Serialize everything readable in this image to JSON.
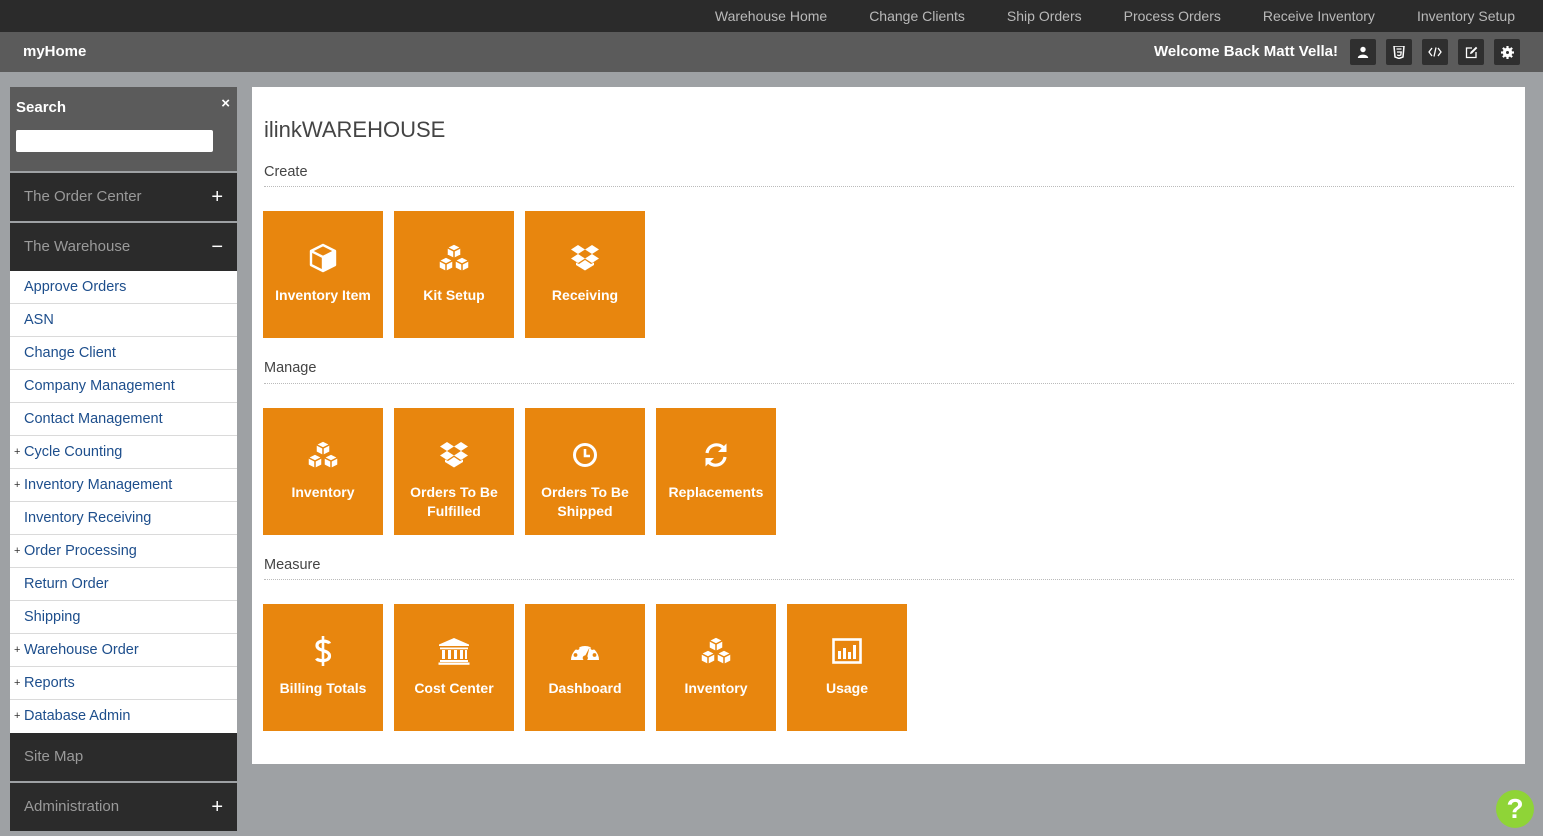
{
  "top_nav": [
    "Warehouse Home",
    "Change Clients",
    "Ship Orders",
    "Process Orders",
    "Receive Inventory",
    "Inventory Setup"
  ],
  "header": {
    "brand": "myHome",
    "welcome": "Welcome Back Matt Vella!",
    "buttons": [
      "user-icon",
      "html5-icon",
      "code-icon",
      "edit-icon",
      "gear-icon"
    ]
  },
  "sidebar": {
    "search": {
      "title": "Search",
      "close": "×",
      "value": "",
      "placeholder": ""
    },
    "order_center": {
      "label": "The Order Center",
      "toggle": "+"
    },
    "warehouse": {
      "label": "The Warehouse",
      "toggle": "−",
      "items": [
        {
          "label": "Approve Orders",
          "expand": ""
        },
        {
          "label": "ASN",
          "expand": ""
        },
        {
          "label": "Change Client",
          "expand": ""
        },
        {
          "label": "Company Management",
          "expand": ""
        },
        {
          "label": "Contact Management",
          "expand": ""
        },
        {
          "label": "Cycle Counting",
          "expand": "+"
        },
        {
          "label": "Inventory Management",
          "expand": "+"
        },
        {
          "label": "Inventory Receiving",
          "expand": ""
        },
        {
          "label": "Order Processing",
          "expand": "+"
        },
        {
          "label": "Return Order",
          "expand": ""
        },
        {
          "label": "Shipping",
          "expand": ""
        },
        {
          "label": "Warehouse Order",
          "expand": "+"
        },
        {
          "label": "Reports",
          "expand": "+"
        },
        {
          "label": "Database Admin",
          "expand": "+"
        }
      ]
    },
    "site_map": {
      "label": "Site Map"
    },
    "administration": {
      "label": "Administration",
      "toggle": "+"
    }
  },
  "main": {
    "title": "ilinkWAREHOUSE",
    "tile_color": "#e8860e",
    "groups": [
      {
        "label": "Create",
        "tiles": [
          {
            "icon": "cube-icon",
            "label": "Inventory Item"
          },
          {
            "icon": "cubes-icon",
            "label": "Kit Setup"
          },
          {
            "icon": "dropbox-icon",
            "label": "Receiving"
          }
        ]
      },
      {
        "label": "Manage",
        "tiles": [
          {
            "icon": "cubes-icon",
            "label": "Inventory"
          },
          {
            "icon": "dropbox-icon",
            "label": "Orders To Be Fulfilled"
          },
          {
            "icon": "clock-icon",
            "label": "Orders To Be Shipped"
          },
          {
            "icon": "refresh-icon",
            "label": "Replacements"
          }
        ]
      },
      {
        "label": "Measure",
        "tiles": [
          {
            "icon": "dollar-icon",
            "label": "Billing Totals"
          },
          {
            "icon": "bank-icon",
            "label": "Cost Center"
          },
          {
            "icon": "dashboard-icon",
            "label": "Dashboard"
          },
          {
            "icon": "cubes-icon",
            "label": "Inventory"
          },
          {
            "icon": "bar-chart-icon",
            "label": "Usage"
          }
        ]
      }
    ]
  },
  "help_button": {
    "label": "?"
  }
}
